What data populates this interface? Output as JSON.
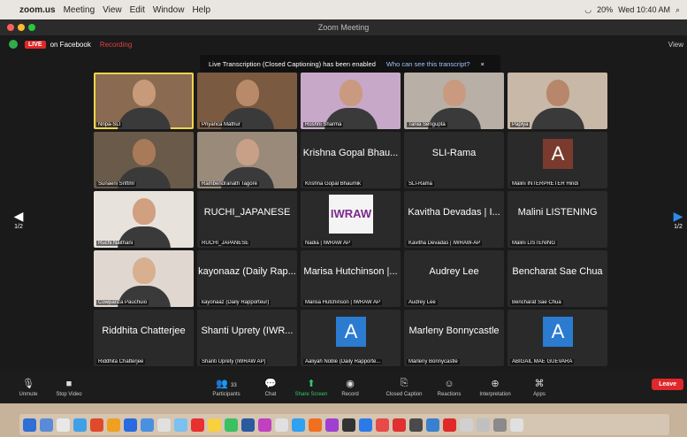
{
  "menubar": {
    "items": [
      "zoom.us",
      "Meeting",
      "View",
      "Edit",
      "Window",
      "Help"
    ],
    "time": "Wed 10:40 AM",
    "battery": "20%"
  },
  "window": {
    "title": "Zoom Meeting"
  },
  "zoombar": {
    "live": "LIVE",
    "platform": "on Facebook",
    "recording": "Recording",
    "view": "View"
  },
  "banner": {
    "text": "Live Transcription (Closed Captioning) has been enabled",
    "link": "Who can see this transcript?",
    "close": "×"
  },
  "pager": {
    "left": "1/2",
    "right": "1/2"
  },
  "tiles": [
    {
      "name": "Nripa-SLI",
      "big": "",
      "type": "video",
      "skin": "#c79a7a",
      "bg": "#8a6a50",
      "active": true
    },
    {
      "name": "Priyanca Mathur",
      "big": "",
      "type": "video",
      "skin": "#b98a6a",
      "bg": "#7a5a40"
    },
    {
      "name": "Roshni Sharma",
      "big": "",
      "type": "video",
      "skin": "#c99a80",
      "bg": "#c8a8c8"
    },
    {
      "name": "Tania Sengupta",
      "big": "",
      "type": "video",
      "skin": "#c99a80",
      "bg": "#b8b0a6"
    },
    {
      "name": "Paplya",
      "big": "",
      "type": "video",
      "skin": "#b8866a",
      "bg": "#c8b8a8"
    },
    {
      "name": "Sunaeni Sriftmr",
      "big": "",
      "type": "video",
      "skin": "#a87a5a",
      "bg": "#6a5a4a"
    },
    {
      "name": "Rambendranath Tagore",
      "big": "",
      "type": "video",
      "skin": "#c8a088",
      "bg": "#9a8a7a"
    },
    {
      "name": "Krishna Gopal Bhaumik",
      "big": "Krishna Gopal Bhau...",
      "type": "text"
    },
    {
      "name": "SLI-Rama",
      "big": "SLI-Rama",
      "type": "text"
    },
    {
      "name": "Malini INTERPRETER Hindi",
      "big": "",
      "type": "avatar",
      "letter": "A",
      "brown": true
    },
    {
      "name": "Ruchi Naithani",
      "big": "",
      "type": "video",
      "skin": "#d0a080",
      "bg": "#e8e2dc"
    },
    {
      "name": "RUCHI_JAPANESE",
      "big": "RUCHI_JAPANESE",
      "type": "text"
    },
    {
      "name": "Nadia | IWRAW AP",
      "big": "IWRAW",
      "type": "logo"
    },
    {
      "name": "Kavitha Devadas | IWRAW-AP",
      "big": "Kavitha Devadas | I...",
      "type": "text"
    },
    {
      "name": "Malini LISTENING",
      "big": "Malini LISTENING",
      "type": "text"
    },
    {
      "name": "Cowpanza Pauchuio",
      "big": "",
      "type": "video",
      "skin": "#d8b090",
      "bg": "#e0d8d0"
    },
    {
      "name": "kayonaaz (Daily Rapporteur)",
      "big": "kayonaaz (Daily Rap...",
      "type": "text"
    },
    {
      "name": "Marisa Hutchinson | IWRAW AP",
      "big": "Marisa Hutchinson |...",
      "type": "text"
    },
    {
      "name": "Audrey Lee",
      "big": "Audrey Lee",
      "type": "text"
    },
    {
      "name": "Bencharat Sae Chua",
      "big": "Bencharat Sae Chua",
      "type": "text"
    },
    {
      "name": "Riddhita Chatterjee",
      "big": "Riddhita Chatterjee",
      "type": "text"
    },
    {
      "name": "Shanti Uprety (IWRAW AP)",
      "big": "Shanti Uprety (IWR...",
      "type": "text"
    },
    {
      "name": "Aaliyah Noble (Daily Rapporte...",
      "big": "",
      "type": "avatar",
      "letter": "A"
    },
    {
      "name": "Marleny Bonnycastle",
      "big": "Marleny Bonnycastle",
      "type": "text"
    },
    {
      "name": "ABIGAIL MAE GUEVARA",
      "big": "",
      "type": "avatar",
      "letter": "A"
    }
  ],
  "toolbar": {
    "unmute": "Unmute",
    "stop_video": "Stop Video",
    "participants": "Participants",
    "participants_count": "33",
    "chat": "Chat",
    "share": "Share Screen",
    "record": "Record",
    "cc": "Closed Caption",
    "reactions": "Reactions",
    "interpretation": "Interpretation",
    "apps": "Apps",
    "leave": "Leave"
  },
  "dock": {
    "colors": [
      "#2f6fd6",
      "#5a8bd8",
      "#e8e8e8",
      "#3fa0e8",
      "#e04a2a",
      "#f0a020",
      "#2a6ae0",
      "#4a90e0",
      "#e0e0e0",
      "#7ac0f0",
      "#e83030",
      "#f8d040",
      "#3ac060",
      "#2a5aa0",
      "#c040c0",
      "#e0e0e0",
      "#30a0f0",
      "#f07020",
      "#a040d0",
      "#333333",
      "#2a7ae8",
      "#e84a4a",
      "#e03030",
      "#4a4a4a",
      "#3a80d0",
      "#e02a2a",
      "#d0d0d0",
      "#c0c0c0",
      "#8a8a8a",
      "#e0e0e0"
    ]
  }
}
